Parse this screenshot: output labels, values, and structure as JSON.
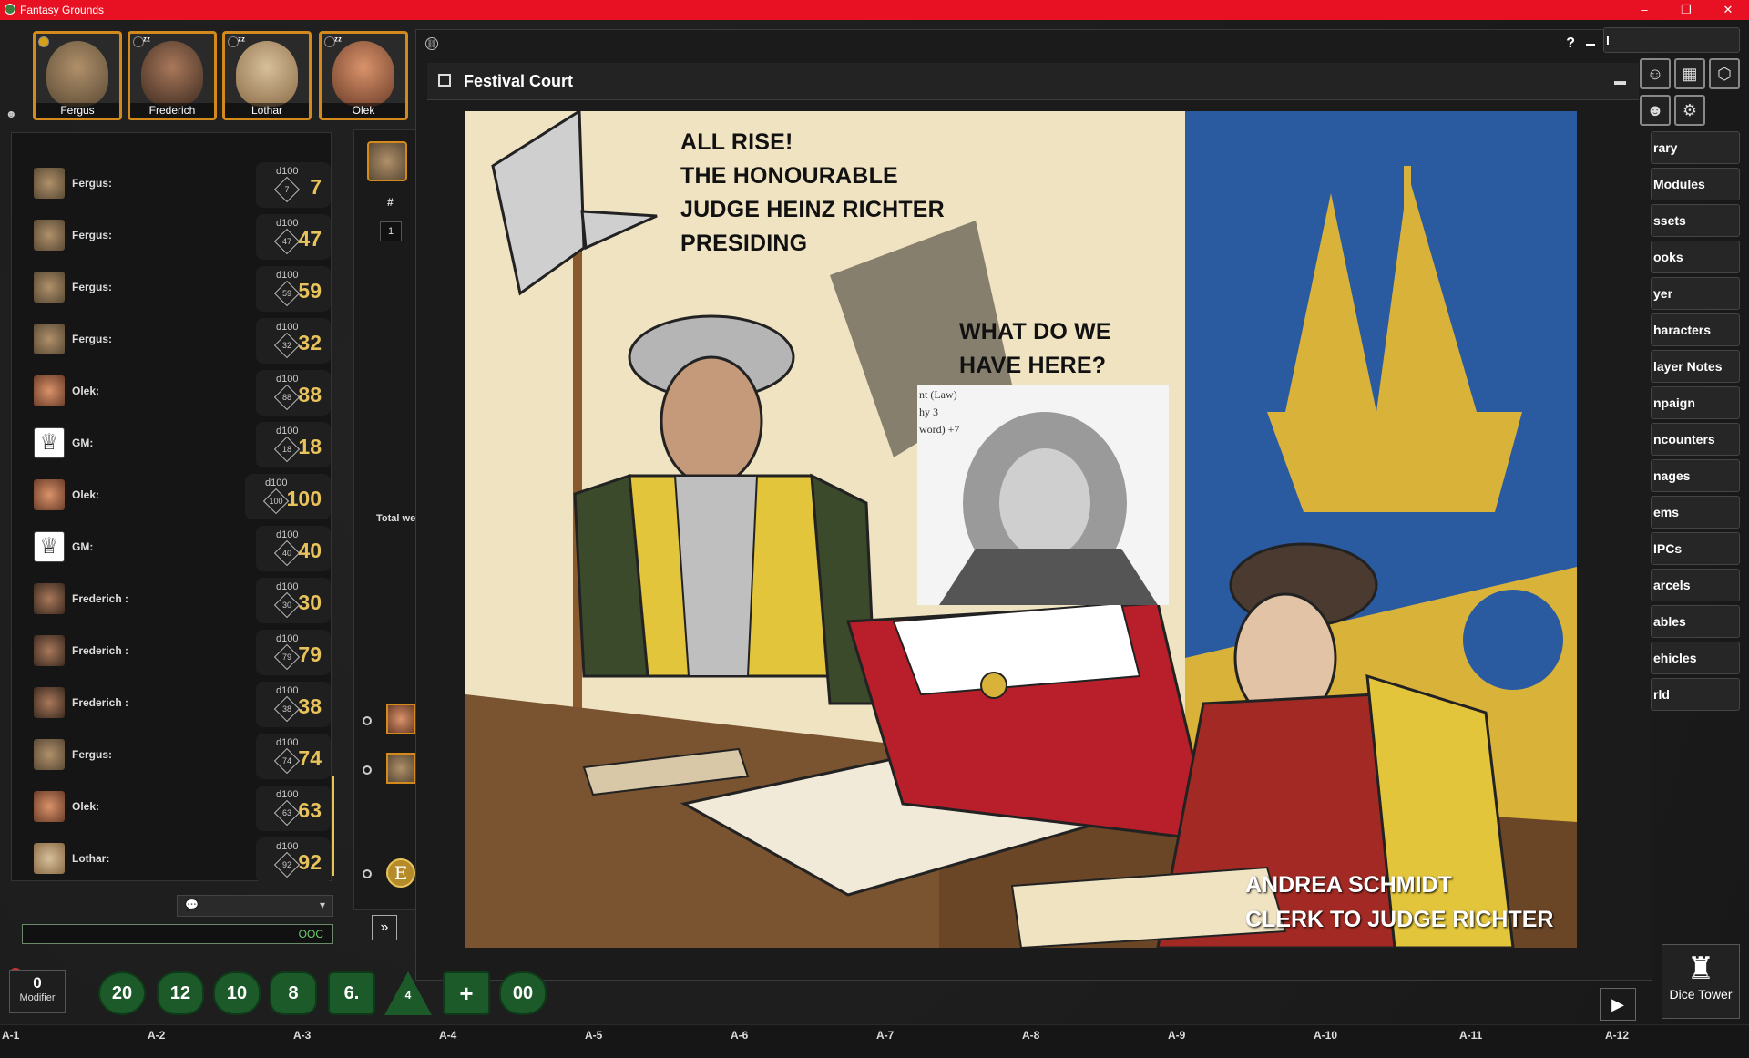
{
  "window": {
    "title": "Fantasy Grounds"
  },
  "party": [
    {
      "name": "Fergus",
      "asleep": false,
      "active": true
    },
    {
      "name": "Frederich",
      "asleep": true,
      "active": false
    },
    {
      "name": "Lothar",
      "asleep": true,
      "active": false
    },
    {
      "name": "Olek",
      "asleep": true,
      "active": false
    }
  ],
  "chat": {
    "messages": [
      {
        "who": "Fergus:",
        "die": "d100",
        "face": "7",
        "total": "7"
      },
      {
        "who": "Fergus:",
        "die": "d100",
        "face": "47",
        "total": "47"
      },
      {
        "who": "Fergus:",
        "die": "d100",
        "face": "59",
        "total": "59"
      },
      {
        "who": "Fergus:",
        "die": "d100",
        "face": "32",
        "total": "32"
      },
      {
        "who": "Olek:",
        "die": "d100",
        "face": "88",
        "total": "88"
      },
      {
        "who": "GM:",
        "die": "d100",
        "face": "18",
        "total": "18"
      },
      {
        "who": "Olek:",
        "die": "d100",
        "face": "100",
        "total": "100"
      },
      {
        "who": "GM:",
        "die": "d100",
        "face": "40",
        "total": "40"
      },
      {
        "who": "Frederich :",
        "die": "d100",
        "face": "30",
        "total": "30"
      },
      {
        "who": "Frederich :",
        "die": "d100",
        "face": "79",
        "total": "79"
      },
      {
        "who": "Frederich :",
        "die": "d100",
        "face": "38",
        "total": "38"
      },
      {
        "who": "Fergus:",
        "die": "d100",
        "face": "74",
        "total": "74"
      },
      {
        "who": "Olek:",
        "die": "d100",
        "face": "63",
        "total": "63"
      },
      {
        "who": "Lothar:",
        "die": "d100",
        "face": "92",
        "total": "92"
      }
    ],
    "input_mode": "OOC"
  },
  "midcol": {
    "hash": "#",
    "row": "1",
    "total_label": "Total we",
    "effect": "E"
  },
  "image_window": {
    "title": "Festival Court",
    "controls": {
      "help": "?",
      "minimize": "▬",
      "maximize": "⤢",
      "close": "✕"
    },
    "caption_lines": [
      "ALL RISE!",
      "THE HONOURABLE",
      "JUDGE HEINZ RICHTER",
      "PRESIDING"
    ],
    "question_lines": [
      "WHAT DO WE",
      "HAVE HERE?"
    ],
    "clerk_lines": [
      "ANDREA SCHMIDT",
      "CLERK TO JUDGE RICHTER"
    ],
    "statblock_text": [
      "nt (Law)",
      "hy 3",
      "word) +7"
    ]
  },
  "library": {
    "header": "l",
    "items": [
      "rary",
      "Modules",
      "ssets",
      "ooks",
      "yer",
      "haracters",
      "layer Notes",
      "npaign",
      "ncounters",
      "nages",
      "ems",
      "IPCs",
      "arcels",
      "ables",
      "ehicles",
      "rld"
    ]
  },
  "dice_tray": {
    "modifier_value": "0",
    "modifier_label": "Modifier",
    "dice": [
      "20",
      "12",
      "10",
      "8",
      "6.",
      "4",
      "+",
      "00"
    ]
  },
  "dice_tower": {
    "label": "Dice Tower"
  },
  "grid_labels": [
    "A-1",
    "A-2",
    "A-3",
    "A-4",
    "A-5",
    "A-6",
    "A-7",
    "A-8",
    "A-9",
    "A-10",
    "A-11",
    "A-12"
  ],
  "colors": {
    "titlebar": "#e81123",
    "accent": "#e8c25a",
    "die_green": "#1d5a2a",
    "portrait_border": "#d38a1a"
  }
}
